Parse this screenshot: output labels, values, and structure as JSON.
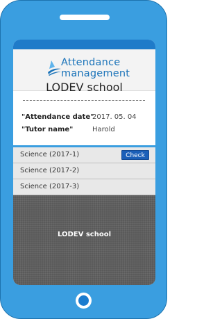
{
  "app": {
    "title_line1": "Attendance",
    "title_line2": "management",
    "school_name": "LODEV school"
  },
  "info": {
    "attendance_date_label": "\"Attendance date\"",
    "attendance_date_value": "2017. 05. 04",
    "tutor_name_label": "\"Tutor name\"",
    "tutor_name_value": "Harold"
  },
  "classes": [
    {
      "label": "Science (2017-1)",
      "action": "Check"
    },
    {
      "label": "Science (2017-2)"
    },
    {
      "label": "Science (2017-3)"
    }
  ],
  "footer": {
    "text": "LODEV school"
  },
  "colors": {
    "phone_body": "#3a9ee0",
    "accent": "#1f7bc9",
    "button": "#1b5fb8",
    "footer": "#5a5a5a"
  },
  "icons": {
    "logo": "swoosh-logo-icon"
  }
}
